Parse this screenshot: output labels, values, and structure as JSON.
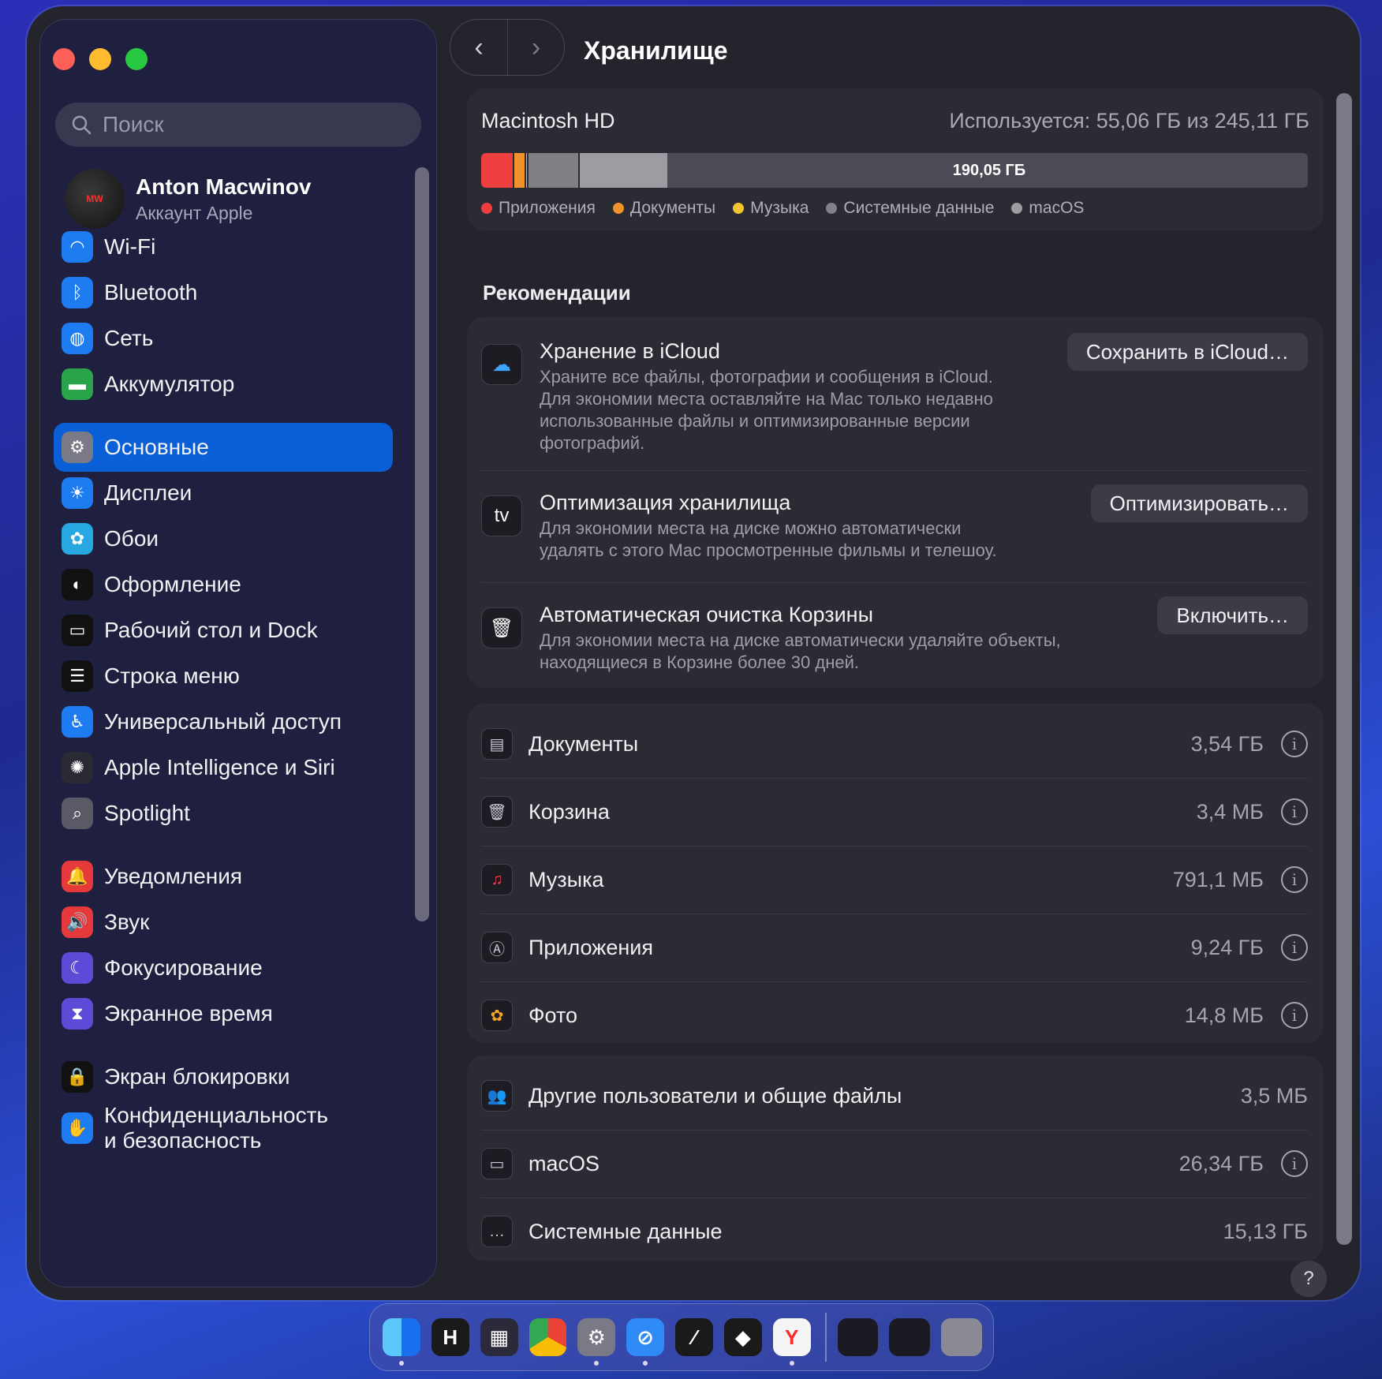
{
  "window": {
    "title": "Хранилище"
  },
  "sidebar": {
    "search_placeholder": "Поиск",
    "profile": {
      "name": "Anton Macwinov",
      "subtitle": "Аккаунт Apple"
    },
    "groups": [
      [
        {
          "label": "Wi-Fi",
          "icon": "wifi-icon",
          "color": "#1e7cf2"
        },
        {
          "label": "Bluetooth",
          "icon": "bluetooth-icon",
          "color": "#1e7cf2"
        },
        {
          "label": "Сеть",
          "icon": "globe-icon",
          "color": "#1e7cf2"
        },
        {
          "label": "Аккумулятор",
          "icon": "battery-icon",
          "color": "#2aa44a"
        }
      ],
      [
        {
          "label": "Основные",
          "icon": "gear-icon",
          "color": "#7a7a86",
          "active": true
        },
        {
          "label": "Дисплеи",
          "icon": "brightness-icon",
          "color": "#1e7cf2"
        },
        {
          "label": "Обои",
          "icon": "flower-icon",
          "color": "#27a8e0"
        },
        {
          "label": "Оформление",
          "icon": "appearance-icon",
          "color": "#111111"
        },
        {
          "label": "Рабочий стол и Dock",
          "icon": "dock-icon",
          "color": "#111111"
        },
        {
          "label": "Строка меню",
          "icon": "menubar-icon",
          "color": "#111111"
        },
        {
          "label": "Универсальный доступ",
          "icon": "accessibility-icon",
          "color": "#1e7cf2"
        },
        {
          "label": "Apple Intelligence и Siri",
          "icon": "siri-icon",
          "color": "#2a2a34"
        },
        {
          "label": "Spotlight",
          "icon": "magnifier-icon",
          "color": "#5a5a66"
        }
      ],
      [
        {
          "label": "Уведомления",
          "icon": "bell-icon",
          "color": "#e5393b"
        },
        {
          "label": "Звук",
          "icon": "speaker-icon",
          "color": "#e5393b"
        },
        {
          "label": "Фокусирование",
          "icon": "moon-icon",
          "color": "#5b4bd6"
        },
        {
          "label": "Экранное время",
          "icon": "hourglass-icon",
          "color": "#5b4bd6"
        }
      ],
      [
        {
          "label": "Экран блокировки",
          "icon": "lock-icon",
          "color": "#111111"
        },
        {
          "label": "Конфиденциальность и безопасность",
          "label_line1": "Конфиденциальность",
          "label_line2": "и безопасность",
          "icon": "hand-icon",
          "color": "#1e7cf2"
        }
      ]
    ]
  },
  "storage": {
    "disk_name": "Macintosh HD",
    "used_text": "Используется: 55,06 ГБ из 245,11 ГБ",
    "free_text": "190,05 ГБ",
    "used_fraction": 0.2246,
    "segments": [
      {
        "label": "Приложения",
        "color": "#ee3e3e",
        "fraction": 0.0377
      },
      {
        "label": "Документы",
        "color": "#f2922b",
        "fraction": 0.0144
      },
      {
        "label": "Музыка",
        "color": "#f4c430",
        "fraction": 0.0032
      },
      {
        "label": "Системные данные",
        "color": "#808086",
        "fraction": 0.0617
      },
      {
        "label": "macOS",
        "color": "#9c9ca2",
        "fraction": 0.1075
      }
    ]
  },
  "recommendations": {
    "heading": "Рекомендации",
    "items": [
      {
        "title": "Хранение в iCloud",
        "desc_lines": [
          "Храните все файлы, фотографии и сообщения в iCloud.",
          "Для экономии места оставляйте на Mac только недавно",
          "использованные файлы и оптимизированные версии",
          "фотографий."
        ],
        "button": "Сохранить в iCloud…",
        "icon": "cloud-icon"
      },
      {
        "title": "Оптимизация хранилища",
        "desc_lines": [
          "Для экономии места на диске можно автоматически",
          "удалять с этого Mac просмотренные фильмы и телешоу."
        ],
        "button": "Оптимизировать…",
        "icon": "appletv-icon",
        "icon_text": "tv"
      },
      {
        "title": "Автоматическая очистка Корзины",
        "desc_lines": [
          "Для экономии места на диске автоматически удаляйте объекты,",
          "находящиеся в Корзине более 30 дней."
        ],
        "button": "Включить…",
        "icon": "trash-icon"
      }
    ]
  },
  "categories": [
    {
      "label": "Документы",
      "size": "3,54 ГБ",
      "icon": "document-icon"
    },
    {
      "label": "Корзина",
      "size": "3,4 МБ",
      "icon": "trash-icon"
    },
    {
      "label": "Музыка",
      "size": "791,1 МБ",
      "icon": "music-icon"
    },
    {
      "label": "Приложения",
      "size": "9,24 ГБ",
      "icon": "appstore-icon"
    },
    {
      "label": "Фото",
      "size": "14,8 МБ",
      "icon": "photos-icon"
    }
  ],
  "system_items": [
    {
      "label": "Другие пользователи и общие файлы",
      "size": "3,5 МБ",
      "icon": "users-icon",
      "info": false
    },
    {
      "label": "macOS",
      "size": "26,34 ГБ",
      "icon": "laptop-icon",
      "info": true
    },
    {
      "label": "Системные данные",
      "size": "15,13 ГБ",
      "icon": "ellipsis-icon",
      "info": false
    }
  ],
  "dock": {
    "apps": [
      {
        "name": "finder",
        "icon": "finder-icon",
        "color": "#2a8cf2",
        "running": true
      },
      {
        "name": "h-app",
        "icon": "h-app-icon",
        "color": "#1a1a1a",
        "glyph": "H",
        "running": false
      },
      {
        "name": "launchpad",
        "icon": "launchpad-icon",
        "color": "#2a2a3a",
        "running": false
      },
      {
        "name": "chrome",
        "icon": "chrome-icon",
        "color": "#e8e8e8",
        "running": false
      },
      {
        "name": "system-settings",
        "icon": "settings-gear-icon",
        "color": "#7a7a86",
        "running": true
      },
      {
        "name": "safari",
        "icon": "compass-icon",
        "color": "#2f8af5",
        "running": true
      },
      {
        "name": "slash-app",
        "icon": "slash-app-icon",
        "color": "#1a1a1a",
        "running": false
      },
      {
        "name": "diamond-app",
        "icon": "diamond-app-icon",
        "color": "#1a1a1a",
        "running": false
      },
      {
        "name": "yandex",
        "icon": "yandex-icon",
        "color": "#f5f5f5",
        "glyph": "Y",
        "running": true
      }
    ],
    "recent": [
      {
        "name": "window-1",
        "icon": "window-thumbnail-icon"
      },
      {
        "name": "window-2",
        "icon": "window-thumbnail-icon"
      },
      {
        "name": "trash",
        "icon": "trash-bin-icon"
      }
    ]
  }
}
